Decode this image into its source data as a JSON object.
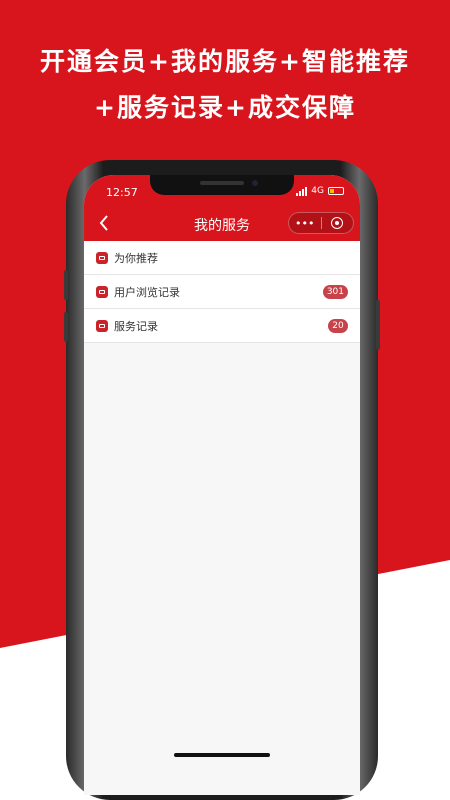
{
  "promo": {
    "line1": "开通会员+我的服务+智能推荐",
    "line2": "+服务记录+成交保障"
  },
  "status_bar": {
    "time": "12:57",
    "network": "4G"
  },
  "navbar": {
    "title": "我的服务",
    "more_glyph": "•••"
  },
  "list": {
    "items": [
      {
        "label": "为你推荐",
        "badge": ""
      },
      {
        "label": "用户浏览记录",
        "badge": "301"
      },
      {
        "label": "服务记录",
        "badge": "20"
      }
    ]
  },
  "colors": {
    "brand_red": "#d8151d",
    "badge_red": "#c8424a"
  }
}
